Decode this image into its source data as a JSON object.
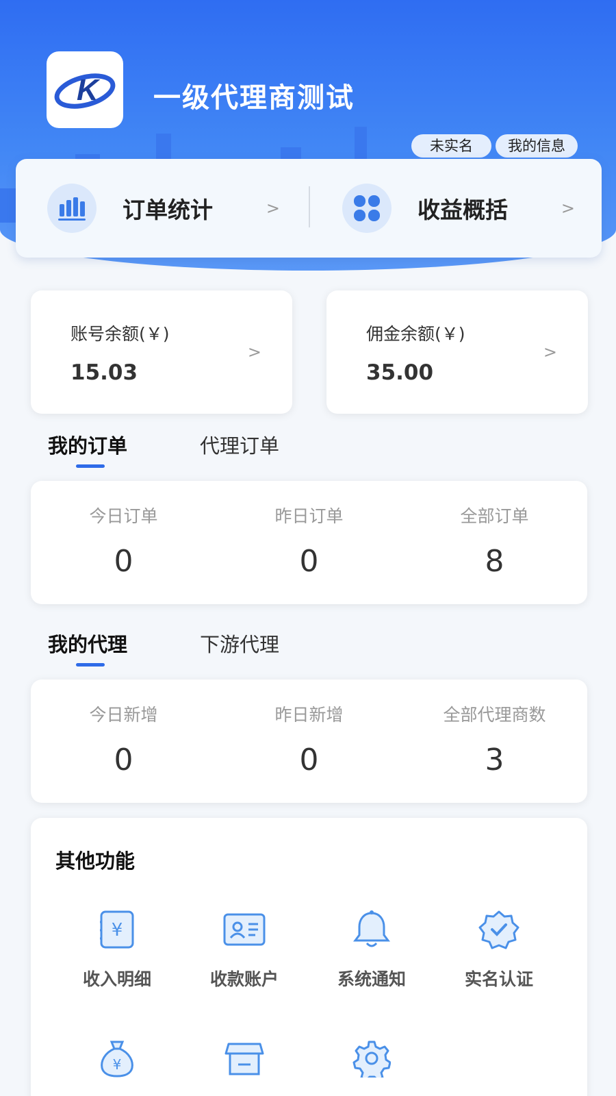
{
  "header": {
    "title": "一级代理商测试",
    "realname_badge": "未实名",
    "myinfo_badge": "我的信息"
  },
  "quick_links": [
    {
      "label": "订单统计",
      "arrow": ">",
      "icon": "bar-chart-icon"
    },
    {
      "label": "收益概括",
      "arrow": ">",
      "icon": "grid-icon"
    }
  ],
  "balances": [
    {
      "label": "账号余额(￥)",
      "value": "15.03",
      "arrow": ">"
    },
    {
      "label": "佣金余额(￥)",
      "value": "35.00",
      "arrow": ">"
    }
  ],
  "orders": {
    "tabs": [
      {
        "label": "我的订单",
        "active": true
      },
      {
        "label": "代理订单",
        "active": false
      }
    ],
    "stats": [
      {
        "label": "今日订单",
        "value": "0"
      },
      {
        "label": "昨日订单",
        "value": "0"
      },
      {
        "label": "全部订单",
        "value": "8"
      }
    ]
  },
  "agents": {
    "tabs": [
      {
        "label": "我的代理",
        "active": true
      },
      {
        "label": "下游代理",
        "active": false
      }
    ],
    "stats": [
      {
        "label": "今日新增",
        "value": "0"
      },
      {
        "label": "昨日新增",
        "value": "0"
      },
      {
        "label": "全部代理商数",
        "value": "3"
      }
    ]
  },
  "other": {
    "title": "其他功能",
    "items": [
      {
        "label": "收入明细",
        "icon": "income-detail-icon"
      },
      {
        "label": "收款账户",
        "icon": "account-card-icon"
      },
      {
        "label": "系统通知",
        "icon": "bell-icon"
      },
      {
        "label": "实名认证",
        "icon": "verified-badge-icon"
      },
      {
        "label": "",
        "icon": "money-bag-icon"
      },
      {
        "label": "",
        "icon": "store-icon"
      },
      {
        "label": "",
        "icon": "gear-icon"
      }
    ]
  },
  "colors": {
    "primary": "#2e6be8",
    "header": "#3b7bf3",
    "icon": "#4a90e8"
  }
}
